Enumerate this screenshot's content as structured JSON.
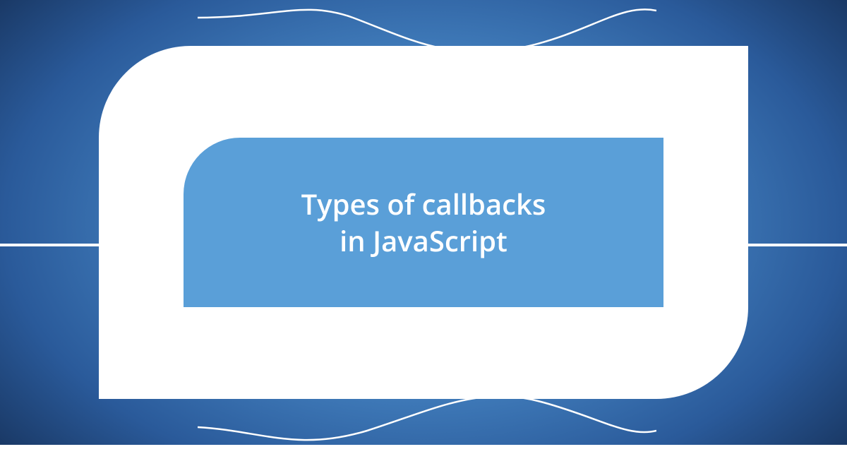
{
  "card": {
    "title_line1": "Types of callbacks",
    "title_line2": "in JavaScript"
  },
  "colors": {
    "inner_panel": "#5a9fd8",
    "frame": "#ffffff",
    "bg_center": "#5a9fd8",
    "bg_edge": "#0d1f3d"
  }
}
